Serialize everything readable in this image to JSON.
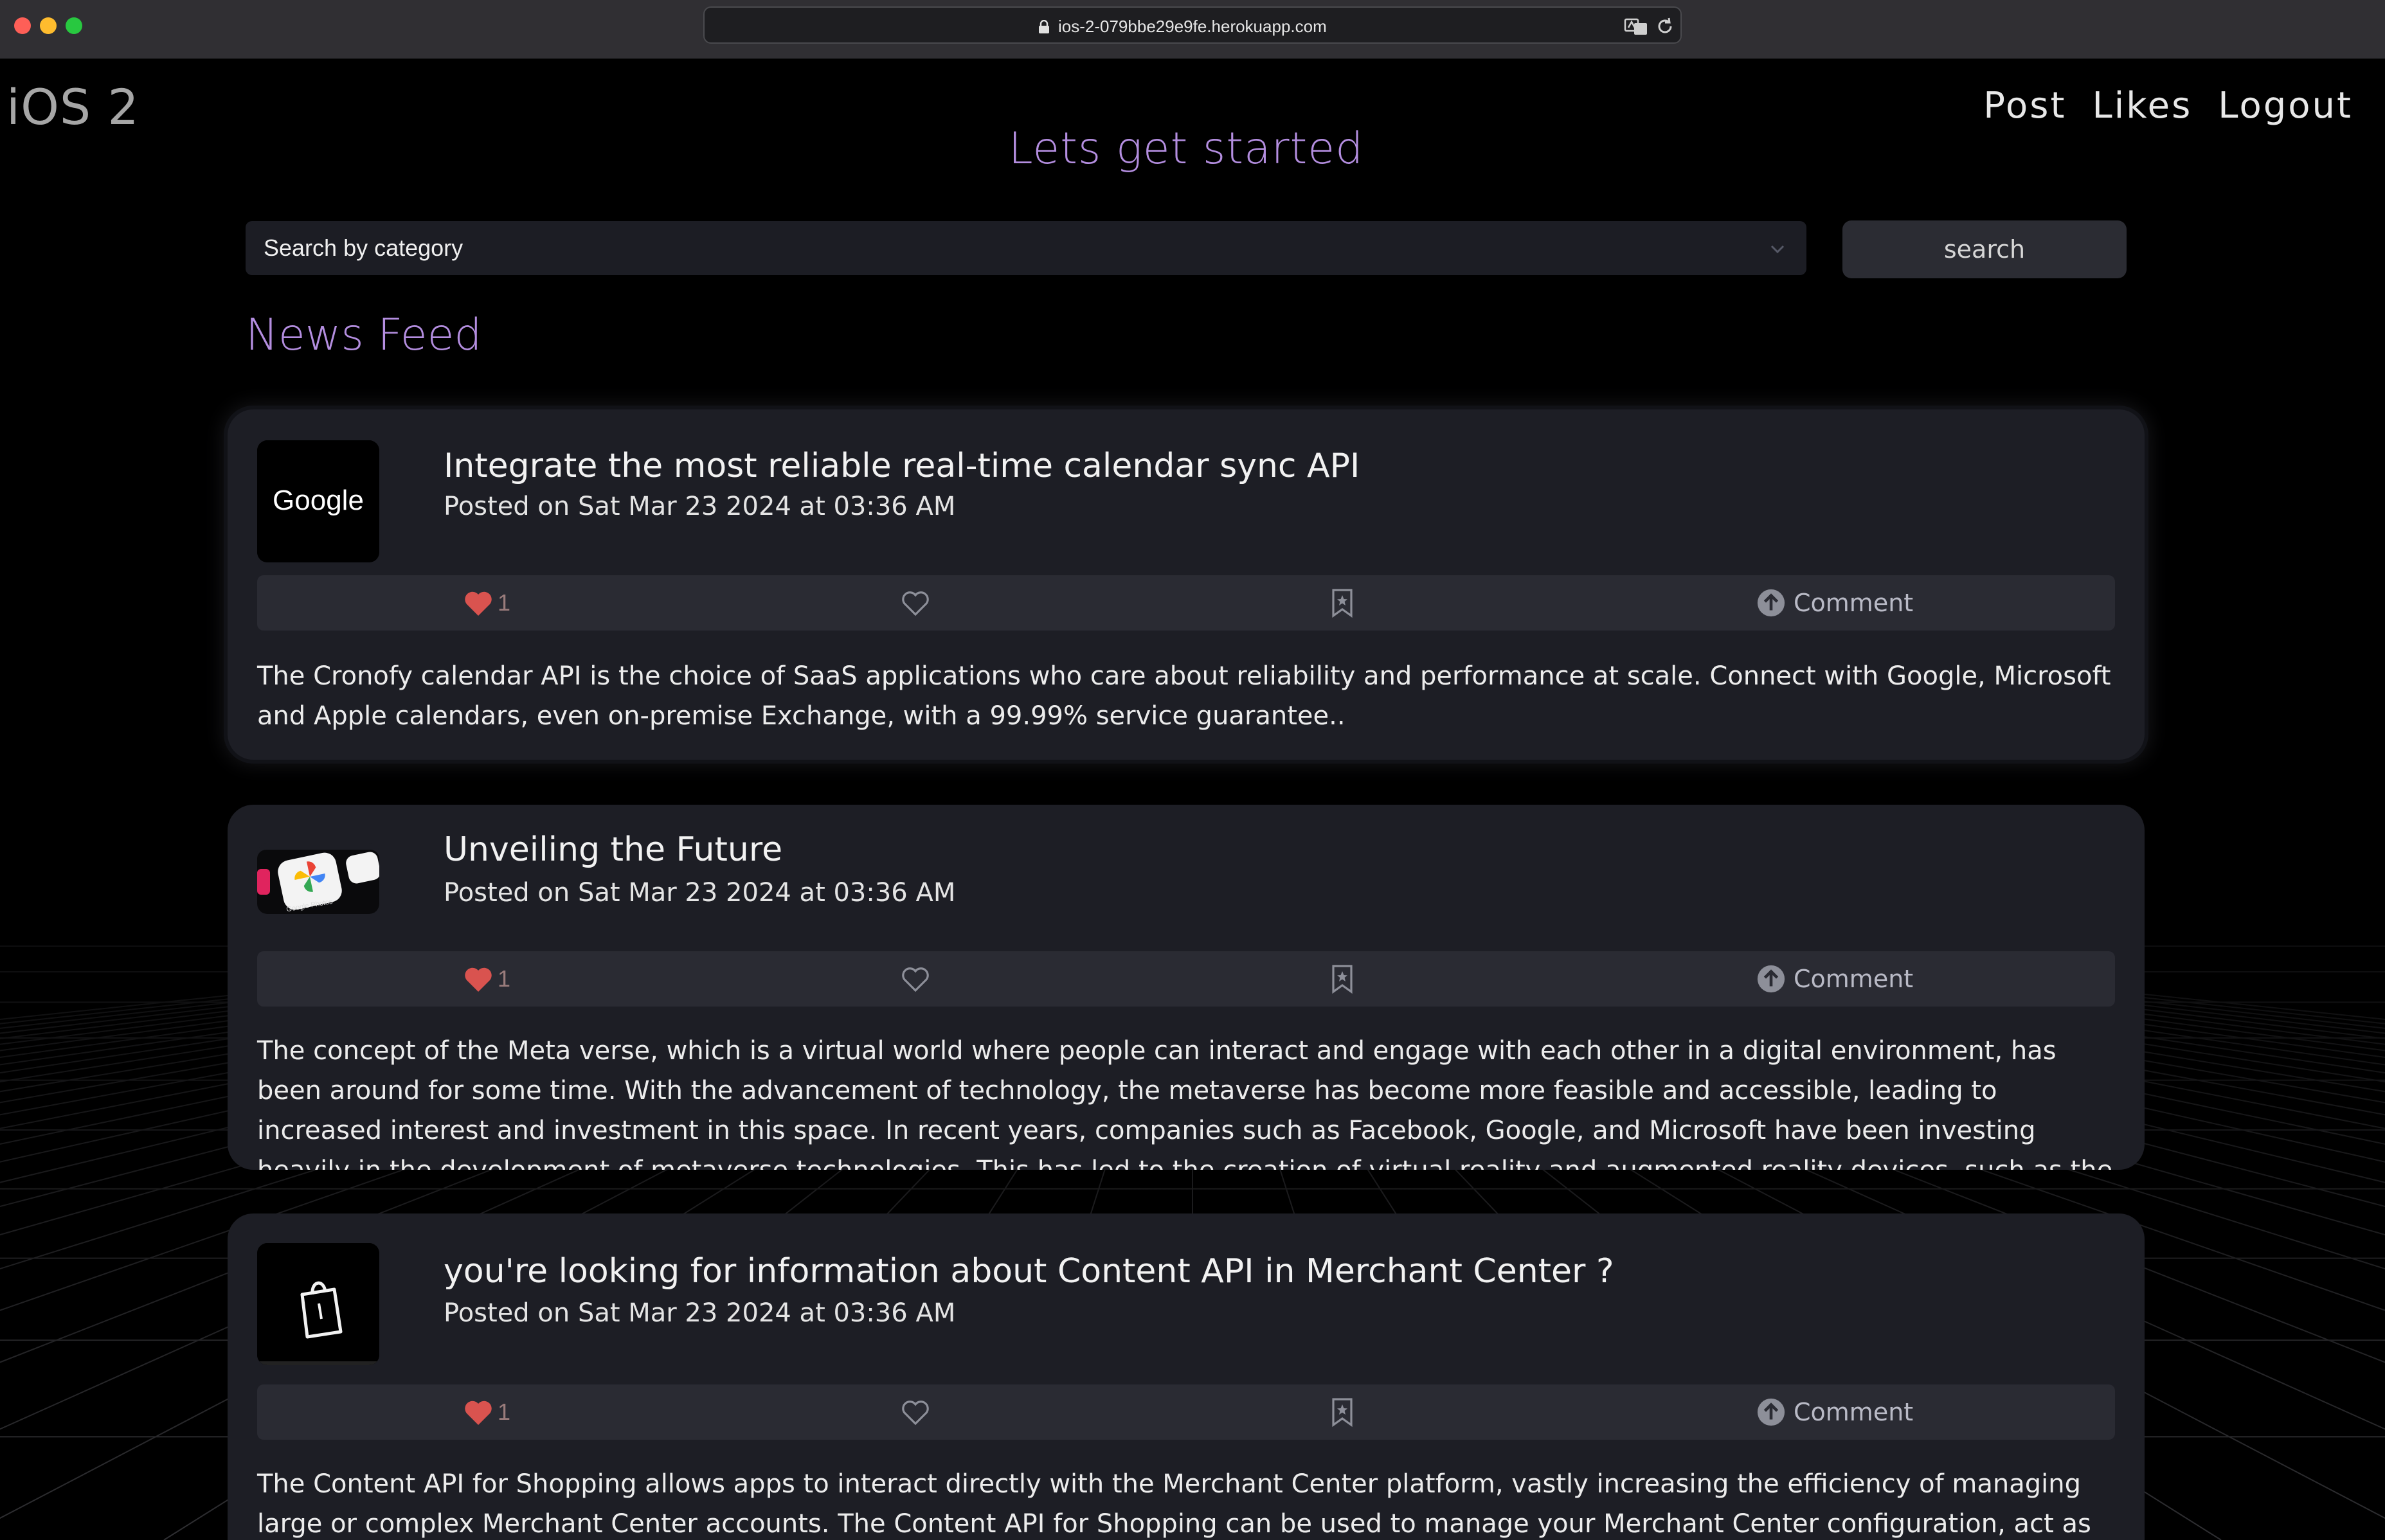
{
  "browser": {
    "url": "ios-2-079bbe29e9fe.herokuapp.com"
  },
  "header": {
    "brand": "iOS 2",
    "nav": [
      "Post",
      "Likes",
      "Logout"
    ]
  },
  "hero": {
    "title": "Lets get started"
  },
  "search": {
    "select_value": "Search by category",
    "button_label": "search"
  },
  "feed": {
    "title": "News Feed",
    "posts": [
      {
        "thumb": "google-logo",
        "thumb_text": "Google",
        "title": "Integrate the most reliable real-time calendar sync API",
        "date": "Posted on Sat Mar 23 2024 at 03:36 AM",
        "likes": "1",
        "comment_label": "Comment",
        "body": "The Cronofy calendar API is the choice of SaaS applications who care about reliability and performance at scale. Connect with Google, Microsoft and Apple calendars, even on-premise Exchange, with a 99.99% service guarantee.."
      },
      {
        "thumb": "google-photos-app-icons",
        "thumb_text": "Google Photos",
        "title": "Unveiling the Future",
        "date": "Posted on Sat Mar 23 2024 at 03:36 AM",
        "likes": "1",
        "comment_label": "Comment",
        "body": "The concept of the Meta verse, which is a virtual world where people can interact and engage with each other in a digital environment, has been around for some time. With the advancement of technology, the metaverse has become more feasible and accessible, leading to increased interest and investment in this space. In recent years, companies such as Facebook, Google, and Microsoft have been investing heavily in the development of metaverse technologies. This has led to the creation of virtual reality and augmented reality devices, such as the Oculus Quest and the HoloLens, which can be used to access the"
      },
      {
        "thumb": "shopping-bag-icon",
        "title": "you're looking for information about Content API in Merchant Center ?",
        "date": "Posted on Sat Mar 23 2024 at 03:36 AM",
        "likes": "1",
        "comment_label": "Comment",
        "body": "The Content API for Shopping allows apps to interact directly with the Merchant Center platform, vastly increasing the efficiency of managing large or complex Merchant Center accounts. The Content API for Shopping can be used to manage your Merchant Center configuration, act as an input source for"
      }
    ]
  },
  "colors": {
    "accent": "#b48ee0",
    "card_bg": "#1d1e25",
    "action_bar_bg": "#2a2b33",
    "heart_filled": "#d9534f"
  }
}
